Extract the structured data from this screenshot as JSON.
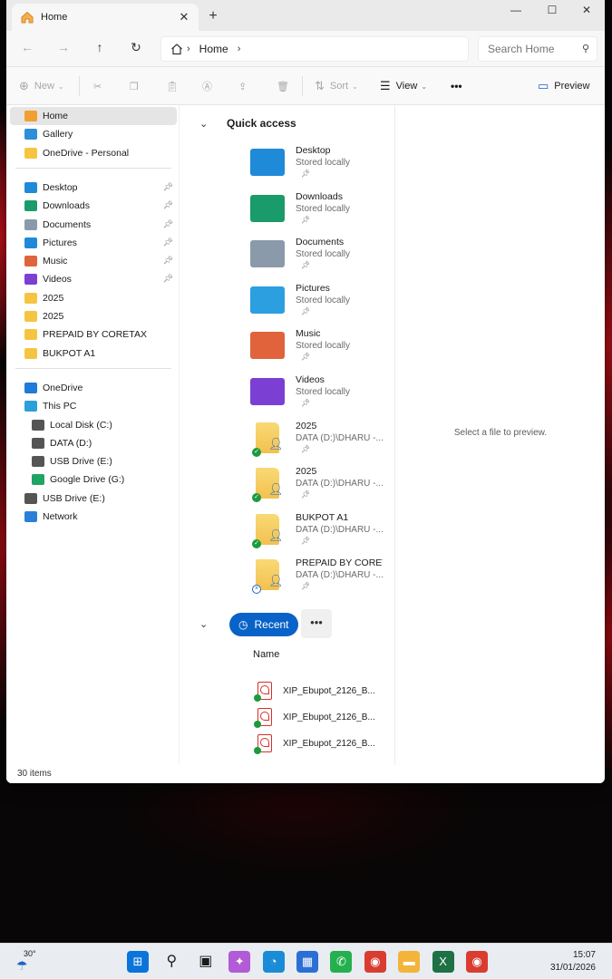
{
  "window": {
    "tab_title": "Home",
    "tab_close": "✕",
    "new_tab": "+",
    "minimize": "—",
    "maximize": "☐",
    "close": "✕"
  },
  "navigation": {
    "breadcrumb": "Home",
    "search_placeholder": "Search Home"
  },
  "toolbar": {
    "new_label": "New",
    "sort_label": "Sort",
    "view_label": "View",
    "more_label": "•••",
    "preview_label": "Preview"
  },
  "sidebar": {
    "top": [
      {
        "label": "Home",
        "icon": "home-icon",
        "color": "#f0a030"
      },
      {
        "label": "Gallery",
        "icon": "gallery-icon",
        "color": "#2b8fd9"
      },
      {
        "label": "OneDrive - Personal",
        "icon": "folder-icon",
        "color": "#f5c542"
      }
    ],
    "pinned": [
      {
        "label": "Desktop",
        "icon": "desktop-icon",
        "color": "#1f8ad8"
      },
      {
        "label": "Downloads",
        "icon": "download-icon",
        "color": "#1a9b6b"
      },
      {
        "label": "Documents",
        "icon": "documents-icon",
        "color": "#8a9aaa"
      },
      {
        "label": "Pictures",
        "icon": "pictures-icon",
        "color": "#1f8ad8"
      },
      {
        "label": "Music",
        "icon": "music-icon",
        "color": "#e0633c"
      },
      {
        "label": "Videos",
        "icon": "videos-icon",
        "color": "#7b3fd4"
      },
      {
        "label": "2025",
        "icon": "shared-folder-icon",
        "color": "#f5c542"
      },
      {
        "label": "2025",
        "icon": "shared-folder-icon",
        "color": "#f5c542"
      },
      {
        "label": "PREPAID BY CORETAX",
        "icon": "shared-folder-icon",
        "color": "#f5c542"
      },
      {
        "label": "BUKPOT A1",
        "icon": "shared-folder-icon",
        "color": "#f5c542"
      }
    ],
    "devices": [
      {
        "label": "OneDrive",
        "icon": "cloud-icon",
        "color": "#1f7ad8",
        "indent": 0
      },
      {
        "label": "This PC",
        "icon": "pc-icon",
        "color": "#2b9fd9",
        "indent": 0
      },
      {
        "label": "Local Disk (C:)",
        "icon": "disk-icon",
        "color": "#555555",
        "indent": 1
      },
      {
        "label": "DATA (D:)",
        "icon": "disk-icon",
        "color": "#555555",
        "indent": 1
      },
      {
        "label": "USB Drive (E:)",
        "icon": "usb-icon",
        "color": "#555555",
        "indent": 1
      },
      {
        "label": "Google Drive (G:)",
        "icon": "google-drive-icon",
        "color": "#1fa463",
        "indent": 1
      },
      {
        "label": "USB Drive (E:)",
        "icon": "usb-icon",
        "color": "#555555",
        "indent": 0
      },
      {
        "label": "Network",
        "icon": "network-icon",
        "color": "#2b7fd9",
        "indent": 0
      }
    ]
  },
  "quick_access": {
    "title": "Quick access",
    "items": [
      {
        "name": "Desktop",
        "sub": "Stored locally",
        "icon": "desktop-folder-icon",
        "color": "#1f8ad8",
        "shared": false,
        "status": ""
      },
      {
        "name": "Downloads",
        "sub": "Stored locally",
        "icon": "downloads-folder-icon",
        "color": "#1a9b6b",
        "shared": false,
        "status": ""
      },
      {
        "name": "Documents",
        "sub": "Stored locally",
        "icon": "documents-folder-icon",
        "color": "#8a9aaa",
        "shared": false,
        "status": ""
      },
      {
        "name": "Pictures",
        "sub": "Stored locally",
        "icon": "pictures-folder-icon",
        "color": "#2b9fe0",
        "shared": false,
        "status": ""
      },
      {
        "name": "Music",
        "sub": "Stored locally",
        "icon": "music-folder-icon",
        "color": "#e0633c",
        "shared": false,
        "status": ""
      },
      {
        "name": "Videos",
        "sub": "Stored locally",
        "icon": "videos-folder-icon",
        "color": "#7b3fd4",
        "shared": false,
        "status": ""
      },
      {
        "name": "2025",
        "sub": "DATA (D:)\\DHARU -...",
        "icon": "shared-folder-icon",
        "color": "#f2c14e",
        "shared": true,
        "status": "ok"
      },
      {
        "name": "2025",
        "sub": "DATA (D:)\\DHARU -...",
        "icon": "shared-folder-icon",
        "color": "#f2c14e",
        "shared": true,
        "status": "ok"
      },
      {
        "name": "BUKPOT A1",
        "sub": "DATA (D:)\\DHARU -...",
        "icon": "shared-folder-icon",
        "color": "#f2c14e",
        "shared": true,
        "status": "ok"
      },
      {
        "name": "PREPAID BY CORETAX",
        "sub": "DATA (D:)\\DHARU -...",
        "icon": "shared-folder-icon",
        "color": "#f2c14e",
        "shared": true,
        "status": "sync"
      }
    ]
  },
  "recent": {
    "label": "Recent",
    "more": "•••",
    "column_name": "Name",
    "files": [
      "XIP_Ebupot_2126_B...",
      "XIP_Ebupot_2126_B...",
      "XIP_Ebupot_2126_B..."
    ]
  },
  "preview_pane": {
    "text": "Select a file to preview."
  },
  "status_bar": {
    "items": "30 items"
  },
  "taskbar": {
    "temperature": "30°",
    "time": "15:07",
    "date": "31/01/2026",
    "apps": [
      {
        "name": "start-icon",
        "color": "#0a74da"
      },
      {
        "name": "search-icon",
        "color": "#1b1b1b"
      },
      {
        "name": "task-view-icon",
        "color": "#1b1b1b"
      },
      {
        "name": "copilot-icon",
        "color": "#b25bd6"
      },
      {
        "name": "edge-icon",
        "color": "#1a8bd6"
      },
      {
        "name": "store-icon",
        "color": "#2b6fd6"
      },
      {
        "name": "whatsapp-icon",
        "color": "#25b04f"
      },
      {
        "name": "chrome-icon",
        "color": "#d93d30"
      },
      {
        "name": "file-explorer-icon",
        "color": "#f2b53a"
      },
      {
        "name": "excel-icon",
        "color": "#1e7145"
      },
      {
        "name": "chrome-profile-icon",
        "color": "#d93d30"
      }
    ]
  }
}
